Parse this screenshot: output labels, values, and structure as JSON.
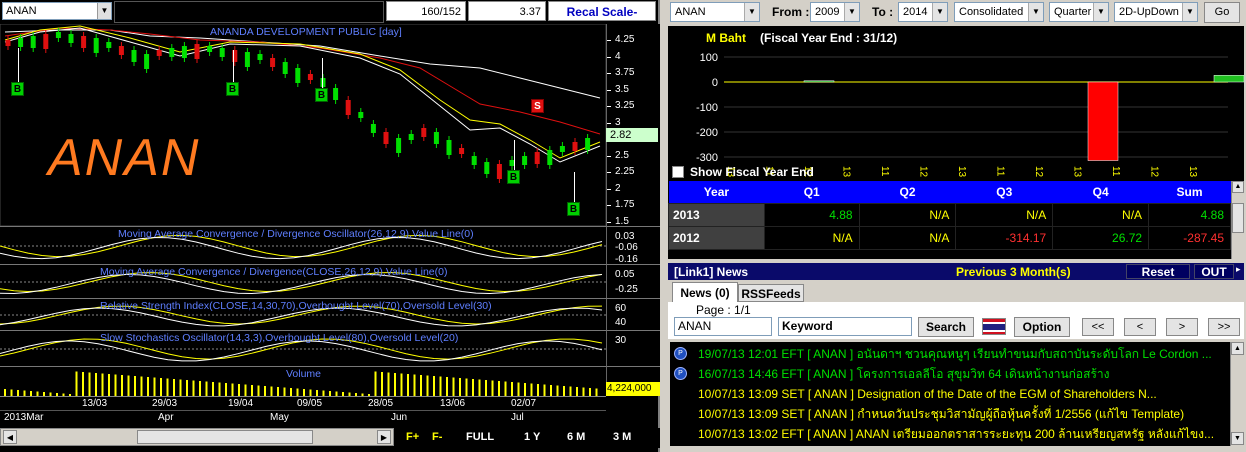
{
  "chart_header": {
    "symbol": "ANAN",
    "ratio": "160/152",
    "last": "3.37",
    "recal_label": "Recal Scale-Linear",
    "company": "ANANDA DEVELOPMENT PUBLIC [day]",
    "watermark": "ANAN",
    "price_tag": "2.82",
    "volume_tag": "4,224,000"
  },
  "price_scale": [
    "4.25",
    "4",
    "3.75",
    "3.5",
    "3.25",
    "3",
    "2.75",
    "2.5",
    "2.25",
    "2",
    "1.75",
    "1.5"
  ],
  "signals": {
    "buy": "B",
    "sell": "S"
  },
  "indicators": [
    {
      "title": "Moving Average Convergence / Divergence Oscillator(26,12,9),Value Line(0)",
      "scale": [
        "0.03",
        "-0.06",
        "-0.16"
      ]
    },
    {
      "title": "Moving Average Convergence / Divergence(CLOSE,26,12,9),Value Line(0)",
      "scale": [
        "0.05",
        "-0.25"
      ]
    },
    {
      "title": "Relative Strength Index(CLOSE,14,30,70),Overbought Level(70),Oversold Level(30)",
      "scale": [
        "60",
        "40"
      ]
    },
    {
      "title": "Slow Stochastics Oscillator(14,3,3),Overbought Level(80),Oversold Level(20)",
      "scale": [
        "30"
      ]
    },
    {
      "title": "Volume",
      "scale": []
    }
  ],
  "x_axis": {
    "dates": [
      "13/03",
      "29/03",
      "19/04",
      "09/05",
      "28/05",
      "13/06",
      "02/07"
    ],
    "months": [
      "2013Mar",
      "Apr",
      "May",
      "Jun",
      "Jul"
    ]
  },
  "toolbar": {
    "fplus": "F+",
    "fminus": "F-",
    "full": "FULL",
    "y1": "1 Y",
    "m6": "6 M",
    "m3": "3 M"
  },
  "right_toolbar": {
    "symbol": "ANAN",
    "from_label": "From :",
    "from_value": "2009",
    "to_label": "To :",
    "to_value": "2014",
    "mode": "Consolidated",
    "period": "Quarter",
    "view": "2D-UpDown",
    "go": "Go"
  },
  "fin_chart": {
    "unit": "M Baht",
    "fiscal": "(Fiscal Year End : 31/12)",
    "yticks": [
      "100",
      "0",
      "-100",
      "-200",
      "-300"
    ],
    "xlabels": [
      "13",
      "11",
      "12",
      "13",
      "11",
      "12",
      "13",
      "11",
      "12",
      "13",
      "11",
      "12",
      "13"
    ],
    "show_fye_label": "Show Fiscal Year End"
  },
  "chart_data": {
    "type": "bar",
    "title": "M Baht",
    "ylim": [
      -320,
      120
    ],
    "series": [
      {
        "values": [
          4.88,
          0,
          0,
          0
        ]
      },
      {
        "values": [
          0,
          0,
          -314.17,
          26.72
        ]
      }
    ],
    "categories": [
      "Q1",
      "Q2",
      "Q3",
      "Q4"
    ]
  },
  "fin_table": {
    "headers": [
      "Year",
      "Q1",
      "Q2",
      "Q3",
      "Q4",
      "Sum"
    ],
    "rows": [
      [
        "2013",
        "4.88",
        "N/A",
        "N/A",
        "N/A",
        "4.88"
      ],
      [
        "2012",
        "N/A",
        "N/A",
        "-314.17",
        "26.72",
        "-287.45"
      ]
    ],
    "colors": {
      "positive": "#00e000",
      "na": "#ffff00",
      "negative": "#ff3030"
    }
  },
  "news": {
    "link": "[Link1] News",
    "period": "Previous 3 Month(s)",
    "reset": "Reset",
    "out": "OUT",
    "tab_news": "News (0)",
    "tab_rss": "RSSFeeds",
    "page": "Page : 1/1",
    "symbol_value": "ANAN",
    "keyword_placeholder": "Keyword",
    "search": "Search",
    "option": "Option",
    "nav": [
      "<<",
      "<",
      ">",
      ">>"
    ],
    "rows": [
      {
        "dt": "19/07/13 12:01",
        "src": "EFT",
        "sym": "[ ANAN ]",
        "text": "อนันดาฯ ชวนคุณหนูๆ เรียนทำขนมกับสถาบันระดับโลก Le Cordon ...",
        "dt_color": "#00e000",
        "icon": true
      },
      {
        "dt": "16/07/13 14:46",
        "src": "EFT",
        "sym": "[ ANAN ]",
        "text": "โครงการเอลลีโอ สุขุมวิท 64 เดินหน้างานก่อสร้าง",
        "dt_color": "#00e000",
        "icon": true
      },
      {
        "dt": "10/07/13 13:09",
        "src": "SET",
        "sym": "[ ANAN ]",
        "text": "Designation of the Date of the EGM of Shareholders N...",
        "dt_color": "#ffff00",
        "icon": false
      },
      {
        "dt": "10/07/13 13:09",
        "src": "SET",
        "sym": "[ ANAN ]",
        "text": "กำหนดวันประชุมวิสามัญผู้ถือหุ้นครั้งที่ 1/2556 (แก้ไข Template)",
        "dt_color": "#ffff00",
        "icon": false
      },
      {
        "dt": "10/07/13 13:02",
        "src": "EFT",
        "sym": "[ ANAN ]",
        "text": "ANAN เตรียมออกตราสารระยะทุน 200 ล้านเหรียญสหรัฐ หลังแก้ไขง...",
        "dt_color": "#ffff00",
        "icon": false
      }
    ]
  }
}
